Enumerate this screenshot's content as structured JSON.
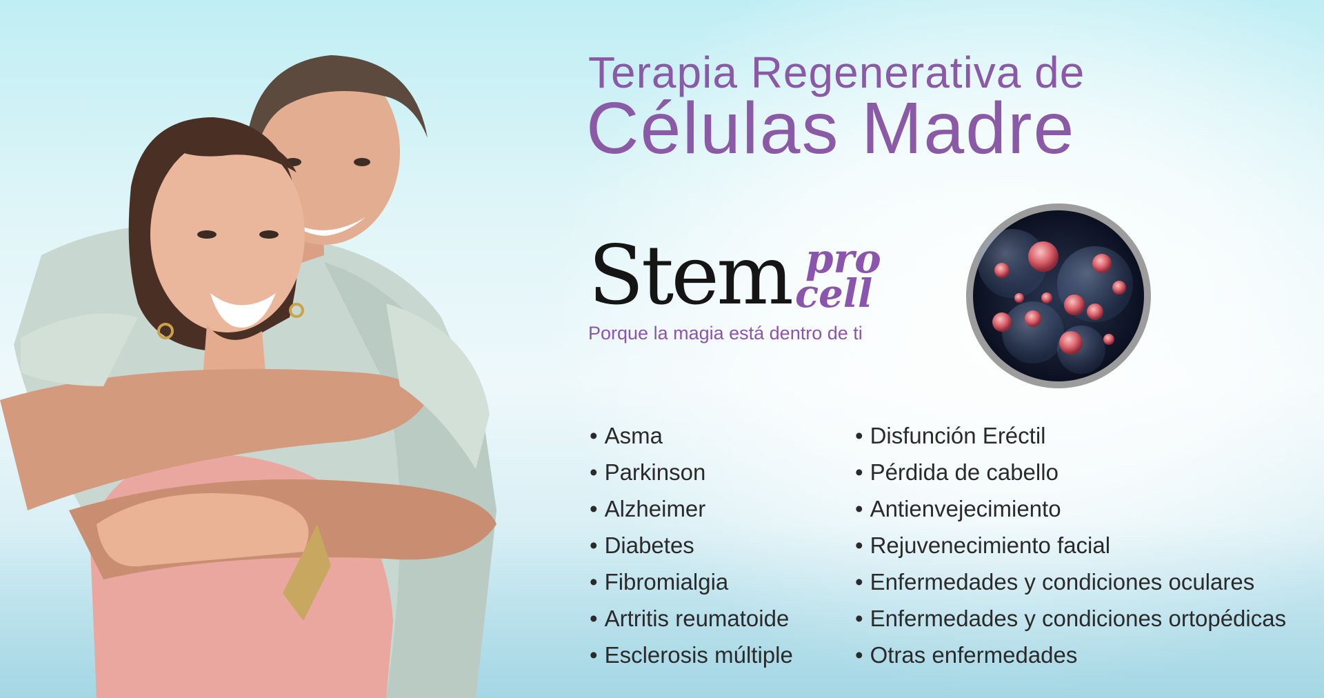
{
  "title": {
    "line1": "Terapia Regenerativa de",
    "line2": "Células Madre"
  },
  "logo": {
    "wordmark": "Stem",
    "pro": "pro",
    "cell": "cell",
    "tagline": "Porque la magia está dentro de ti"
  },
  "conditions_left": [
    "Asma",
    "Parkinson",
    "Alzheimer",
    "Diabetes",
    "Fibromialgia",
    "Artritis reumatoide",
    "Esclerosis múltiple"
  ],
  "conditions_right": [
    "Disfunción Eréctil",
    "Pérdida de cabello",
    "Antienvejecimiento",
    "Rejuvenecimiento facial",
    "Enfermedades y condiciones oculares",
    "Enfermedades y condiciones ortopédicas",
    "Otras enfermedades"
  ],
  "colors": {
    "accent_purple": "#8a5aa7",
    "text_dark": "#2a2a2a",
    "sky_light": "#dff5f8"
  }
}
